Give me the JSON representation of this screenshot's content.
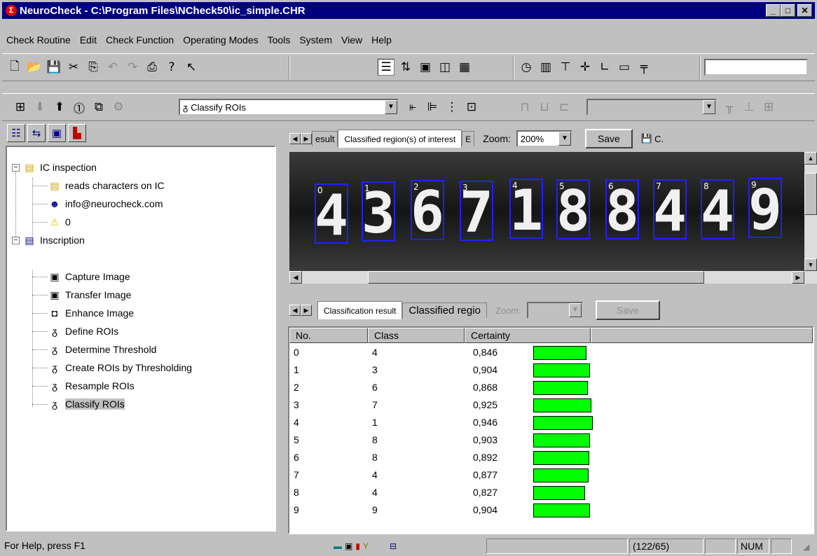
{
  "title": "NeuroCheck - C:\\Program Files\\NCheck50\\ic_simple.CHR",
  "menu": [
    "Check Routine",
    "Edit",
    "Check Function",
    "Operating Modes",
    "Tools",
    "System",
    "View",
    "Help"
  ],
  "toolbar2": {
    "function_combo": "Classify ROIs"
  },
  "tree": {
    "items": [
      {
        "label": "IC inspection",
        "icon": "check-routine-icon"
      },
      {
        "label": "reads characters on IC",
        "icon": "document-icon"
      },
      {
        "label": "info@neurocheck.com",
        "icon": "author-icon"
      },
      {
        "label": "0",
        "icon": "warning-icon"
      },
      {
        "label": "Inscription",
        "icon": "check-icon"
      },
      {
        "label": "Capture Image",
        "icon": "camera-icon"
      },
      {
        "label": "Transfer Image",
        "icon": "camera-icon"
      },
      {
        "label": "Enhance Image",
        "icon": "enhance-icon"
      },
      {
        "label": "Define ROIs",
        "icon": "roi-icon"
      },
      {
        "label": "Determine Threshold",
        "icon": "roi-icon"
      },
      {
        "label": "Create ROIs by Thresholding",
        "icon": "roi-icon"
      },
      {
        "label": "Resample ROIs",
        "icon": "roi-icon"
      },
      {
        "label": "Classify ROIs",
        "icon": "roi-icon"
      }
    ]
  },
  "image_view": {
    "tab_prev": "esult",
    "tab_active": "Classified region(s) of interest",
    "tab_next": "E",
    "zoom_label": "Zoom:",
    "zoom_value": "200%",
    "save_label": "Save",
    "extra_label": "C.",
    "roi_indices": [
      "0",
      "1",
      "2",
      "3",
      "4",
      "5",
      "6",
      "7",
      "8",
      "9"
    ],
    "characters": [
      "4",
      "3",
      "6",
      "7",
      "1",
      "8",
      "8",
      "4",
      "4",
      "9"
    ]
  },
  "result_view": {
    "tab_active": "Classification result",
    "tab_next": "Classified regio",
    "zoom_label": "Zoom:",
    "save_label": "Save",
    "columns": [
      "No.",
      "Class",
      "Certainty"
    ],
    "rows": [
      {
        "no": "0",
        "class": "4",
        "certainty": "0,846",
        "value": 0.846
      },
      {
        "no": "1",
        "class": "3",
        "certainty": "0,904",
        "value": 0.904
      },
      {
        "no": "2",
        "class": "6",
        "certainty": "0,868",
        "value": 0.868
      },
      {
        "no": "3",
        "class": "7",
        "certainty": "0,925",
        "value": 0.925
      },
      {
        "no": "4",
        "class": "1",
        "certainty": "0,946",
        "value": 0.946
      },
      {
        "no": "5",
        "class": "8",
        "certainty": "0,903",
        "value": 0.903
      },
      {
        "no": "6",
        "class": "8",
        "certainty": "0,892",
        "value": 0.892
      },
      {
        "no": "7",
        "class": "4",
        "certainty": "0,877",
        "value": 0.877
      },
      {
        "no": "8",
        "class": "4",
        "certainty": "0,827",
        "value": 0.827
      },
      {
        "no": "9",
        "class": "9",
        "certainty": "0,904",
        "value": 0.904
      }
    ],
    "bar_color": "#00ff00"
  },
  "status": {
    "help": "For Help, press F1",
    "coords": "(122/65)",
    "num": "NUM"
  }
}
